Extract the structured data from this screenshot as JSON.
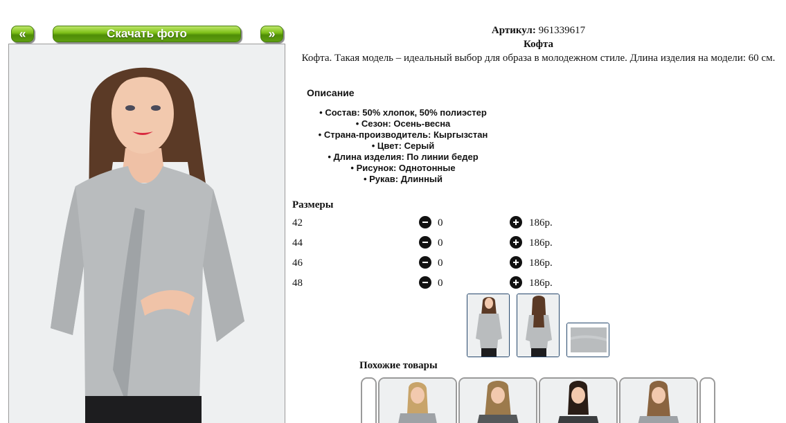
{
  "nav": {
    "prev_label": "«",
    "download_label": "Скачать фото",
    "next_label": "»"
  },
  "product": {
    "article_label": "Артикул:",
    "article_value": "961339617",
    "name": "Кофта",
    "description": "Кофта. Такая модель – идеальный выбор для образа в молодежном стиле. Длина изделия на модели: 60 см."
  },
  "description_section": {
    "title": "Описание",
    "properties": [
      "Состав: 50% хлопок, 50% полиэстер",
      "Сезон: Осень-весна",
      "Страна-производитель: Кыргызстан",
      "Цвет: Серый",
      "Длина изделия: По линии бедер",
      "Рисунок: Однотонные",
      "Рукав: Длинный"
    ]
  },
  "sizes": {
    "title": "Размеры",
    "rows": [
      {
        "size": "42",
        "qty": "0",
        "price": "186р."
      },
      {
        "size": "44",
        "qty": "0",
        "price": "186р."
      },
      {
        "size": "46",
        "qty": "0",
        "price": "186р."
      },
      {
        "size": "48",
        "qty": "0",
        "price": "186р."
      }
    ]
  },
  "similar": {
    "title": "Похожие товары"
  },
  "icons": {
    "minus": "minus-circle-icon",
    "plus": "plus-circle-icon"
  },
  "colors": {
    "button_green": "#6aa811",
    "garment_gray": "#b9bcbe",
    "thumb_border": "#24466b"
  }
}
